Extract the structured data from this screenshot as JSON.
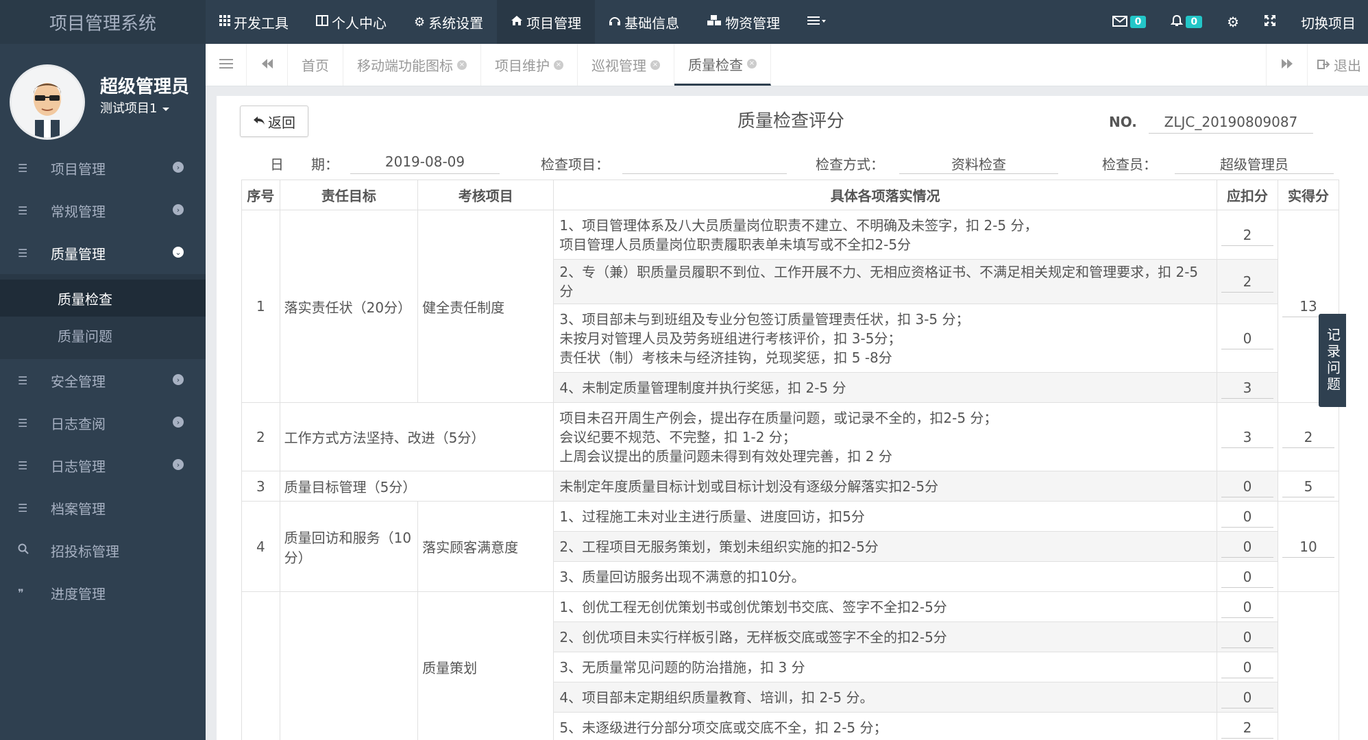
{
  "app": {
    "title": "项目管理系统"
  },
  "topnav": [
    {
      "icon": "grid-icon",
      "label": "开发工具"
    },
    {
      "icon": "window-icon",
      "label": "个人中心"
    },
    {
      "icon": "gear-icon",
      "label": "系统设置"
    },
    {
      "icon": "home-icon",
      "label": "项目管理",
      "active": true
    },
    {
      "icon": "headphones-icon",
      "label": "基础信息"
    },
    {
      "icon": "cubes-icon",
      "label": "物资管理"
    }
  ],
  "topright": {
    "mail_count": "0",
    "bell_count": "0",
    "switch_project": "切换项目"
  },
  "user": {
    "name": "超级管理员",
    "project": "测试项目1"
  },
  "sidebar": {
    "items": [
      {
        "label": "项目管理"
      },
      {
        "label": "常规管理"
      },
      {
        "label": "质量管理",
        "open": true
      },
      {
        "label": "安全管理"
      },
      {
        "label": "日志查阅"
      },
      {
        "label": "日志管理"
      },
      {
        "label": "档案管理"
      },
      {
        "label": "招投标管理"
      },
      {
        "label": "进度管理"
      }
    ],
    "sub_items": [
      {
        "label": "质量检查",
        "active": true
      },
      {
        "label": "质量问题"
      }
    ]
  },
  "tabs": [
    {
      "label": "首页"
    },
    {
      "label": "移动端功能图标"
    },
    {
      "label": "项目维护"
    },
    {
      "label": "巡视管理"
    },
    {
      "label": "质量检查",
      "active": true
    }
  ],
  "tabbar": {
    "logout": "退出"
  },
  "form": {
    "back": "返回",
    "title": "质量检查评分",
    "no_label": "NO.",
    "no_value": "ZLJC_20190809087",
    "date_label": "日　　期：",
    "date_value": "2019-08-09",
    "item_label": "检查项目：",
    "item_value": "",
    "method_label": "检查方式：",
    "method_value": "资料检查",
    "inspector_label": "检查员：",
    "inspector_value": "超级管理员"
  },
  "table": {
    "headers": [
      "序号",
      "责任目标",
      "考核项目",
      "具体各项落实情况",
      "应扣分",
      "实得分"
    ],
    "rows": [
      {
        "seq": "1",
        "target": "落实责任状（20分）",
        "item": "健全责任制度",
        "detail": "1、项目管理体系及八大员质量岗位职责不建立、不明确及未签字，扣 2-5 分，\n项目管理人员质量岗位职责履职表单未填写或不全扣2-5分",
        "deduct": "2",
        "score": "13"
      },
      {
        "detail": "2、专（兼）职质量员履职不到位、工作开展不力、无相应资格证书、不满足相关规定和管理要求，扣 2-5 分",
        "deduct": "2"
      },
      {
        "detail": "3、项目部未与到班组及专业分包签订质量管理责任状，扣 3-5 分；\n未按月对管理人员及劳务班组进行考核评价，扣 3-5分；\n责任状（制）考核未与经济挂钩，兑现奖惩，扣 5 -8分",
        "deduct": "0"
      },
      {
        "detail": "4、未制定质量管理制度并执行奖惩，扣 2-5 分",
        "deduct": "3"
      },
      {
        "seq": "2",
        "target": "工作方式方法坚持、改进（5分）",
        "detail": "项目未召开周生产例会，提出存在质量问题，或记录不全的，扣2-5 分；\n会议纪要不规范、不完整，扣 1-2 分；\n上周会议提出的质量问题未得到有效处理完善，扣 2 分",
        "deduct": "3",
        "score": "2"
      },
      {
        "seq": "3",
        "target": "质量目标管理（5分）",
        "detail": "未制定年度质量目标计划或目标计划没有逐级分解落实扣2-5分",
        "deduct": "0",
        "score": "5"
      },
      {
        "seq": "4",
        "target": "质量回访和服务（10分）",
        "item": "落实顾客满意度",
        "detail": "1、过程施工未对业主进行质量、进度回访，扣5分",
        "deduct": "0",
        "score": "10"
      },
      {
        "detail": "2、工程项目无服务策划，策划未组织实施的扣2-5分",
        "deduct": "0"
      },
      {
        "detail": "3、质量回访服务出现不满意的扣10分。",
        "deduct": "0"
      },
      {
        "item": "质量策划",
        "detail": "1、创优工程无创优策划书或创优策划书交底、签字不全扣2-5分",
        "deduct": "0"
      },
      {
        "detail": "2、创优项目未实行样板引路，无样板交底或签字不全的扣2-5分",
        "deduct": "0"
      },
      {
        "detail": "3、无质量常见问题的防治措施，扣 3 分",
        "deduct": "0"
      },
      {
        "detail": "4、项目部未定期组织质量教育、培训，扣 2-5 分。",
        "deduct": "0"
      },
      {
        "detail": "5、未逐级进行分部分项交底或交底不全，扣 2-5 分；",
        "deduct": "2"
      }
    ]
  },
  "float_button": "记录问题",
  "colors": {
    "sidebar": "#2f4050",
    "badge": "#23c6c8"
  }
}
